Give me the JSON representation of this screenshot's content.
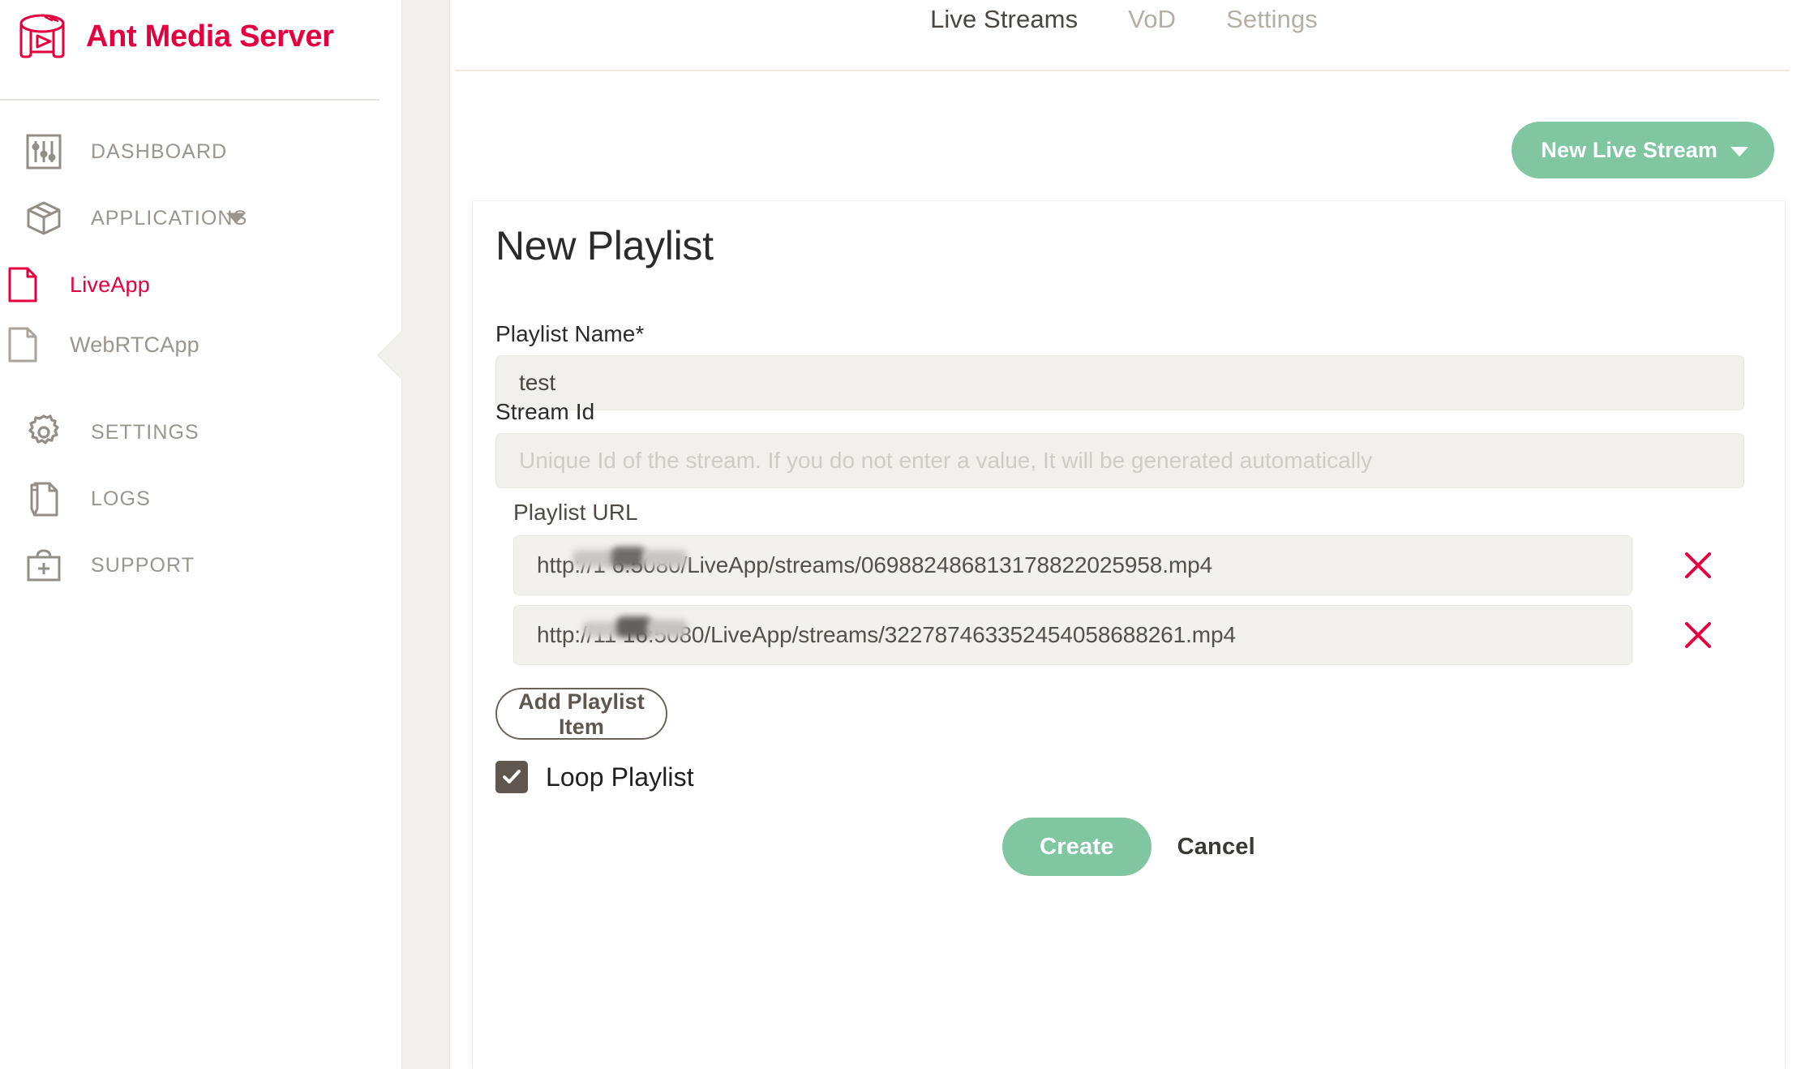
{
  "brand": {
    "title": "Ant Media Server",
    "logo_icon": "ant-media-logo-icon",
    "color": "#e4003f"
  },
  "sidebar": {
    "items": [
      {
        "label": "DASHBOARD",
        "icon": "sliders-icon",
        "active": false
      },
      {
        "label": "APPLICATIONS",
        "icon": "box-icon",
        "active": false,
        "has_caret": true
      },
      {
        "label": "LiveApp",
        "icon": "file-icon",
        "active": true,
        "sub": true
      },
      {
        "label": "WebRTCApp",
        "icon": "file-icon",
        "active": false,
        "sub": true
      },
      {
        "label": "SETTINGS",
        "icon": "gear-icon",
        "active": false
      },
      {
        "label": "LOGS",
        "icon": "file-pencil-icon",
        "active": false
      },
      {
        "label": "SUPPORT",
        "icon": "first-aid-kit-icon",
        "active": false
      }
    ]
  },
  "tabs": [
    {
      "label": "Live Streams",
      "active": true
    },
    {
      "label": "VoD",
      "active": false
    },
    {
      "label": "Settings",
      "active": false
    }
  ],
  "toolbar": {
    "new_live_stream_label": "New Live Stream",
    "caret_icon": "chevron-down-icon",
    "accent_color": "#7fc6a1"
  },
  "form": {
    "title": "New Playlist",
    "playlist_name": {
      "label": "Playlist Name*",
      "value": "test"
    },
    "stream_id": {
      "label": "Stream Id",
      "value": "",
      "placeholder": "Unique Id of the stream. If you do not enter a value, It will be generated automatically"
    },
    "playlist_url": {
      "label": "Playlist URL",
      "items": [
        {
          "value": "http://1                 6:5080/LiveApp/streams/069882486813178822025958.mp4",
          "remove_icon": "close-x-icon"
        },
        {
          "value": "http://11                16:5080/LiveApp/streams/322787463352454058688261.mp4",
          "remove_icon": "close-x-icon"
        }
      ]
    },
    "add_item_label": "Add Playlist Item",
    "loop_playlist": {
      "label": "Loop Playlist",
      "checked": true,
      "check_icon": "checkmark-icon"
    },
    "create_label": "Create",
    "cancel_label": "Cancel"
  },
  "colors": {
    "brand_red": "#e4003f",
    "green": "#7fc6a1",
    "remove_red": "#e4003f",
    "strip": "#f2f0ec",
    "input_bg": "#f2f0ed"
  }
}
